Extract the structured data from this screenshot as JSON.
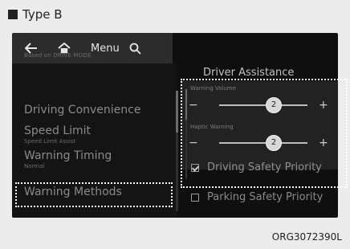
{
  "header": {
    "title": "Type B"
  },
  "topbar": {
    "menu_label": "Menu",
    "icons": [
      "back-icon",
      "home-icon",
      "search-icon"
    ]
  },
  "left_panel": {
    "section_caption": "Based on DRIVE MODE",
    "items": [
      {
        "title": "Driving Convenience",
        "subtitle": ""
      },
      {
        "title": "Speed Limit",
        "subtitle": "Speed Limit Assist"
      },
      {
        "title": "Warning Timing",
        "subtitle": "Normal"
      },
      {
        "title": "Warning Methods",
        "subtitle": ""
      }
    ]
  },
  "right_panel": {
    "title": "Driver Assistance",
    "sliders": [
      {
        "label": "Warning Volume",
        "value": "2"
      },
      {
        "label": "Haptic Warning",
        "value": "2"
      }
    ],
    "checkboxes": [
      {
        "label": "Driving Safety Priority",
        "checked": true
      },
      {
        "label": "Parking Safety Priority",
        "checked": false
      }
    ]
  },
  "footer": {
    "code": "ORG3072390L"
  },
  "colors": {
    "page_background": "#ececec",
    "screen_background": "#0f0f0f",
    "highlight": "#ffffff"
  }
}
